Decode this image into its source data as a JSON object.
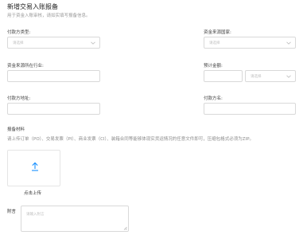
{
  "header": {
    "title": "新增交易入账报备",
    "subtitle": "用于资金入账审核，请如实填写报备信息。"
  },
  "form": {
    "payer_type": {
      "label": "付款方类型:",
      "placeholder": "请选择"
    },
    "fund_source_country": {
      "label": "资金来源国家:",
      "placeholder": "请选择"
    },
    "fund_source_industry": {
      "label": "资金来源所在行业:",
      "value": ""
    },
    "expected_amount": {
      "label": "预计金额:",
      "value": "",
      "currency_placeholder": "请选择"
    },
    "payer_address": {
      "label": "付款方地址:",
      "value": ""
    },
    "payer_name": {
      "label": "付款方名:",
      "value": ""
    }
  },
  "materials": {
    "label": "报备材料",
    "hint": "请上传订单（PO）、交易发票（PI）、商业发票（CI）、装箱合同等能够体现实货运情况的任意文件即可，压缩包格式必须为ZIP。",
    "upload_label": "点击上传",
    "upload_icon": "upload-arrow-icon"
  },
  "note": {
    "label": "附言",
    "placeholder": "请输入附言"
  },
  "colors": {
    "accent": "#1890ff",
    "border": "#d9d9d9",
    "placeholder": "#c0c0c0"
  }
}
